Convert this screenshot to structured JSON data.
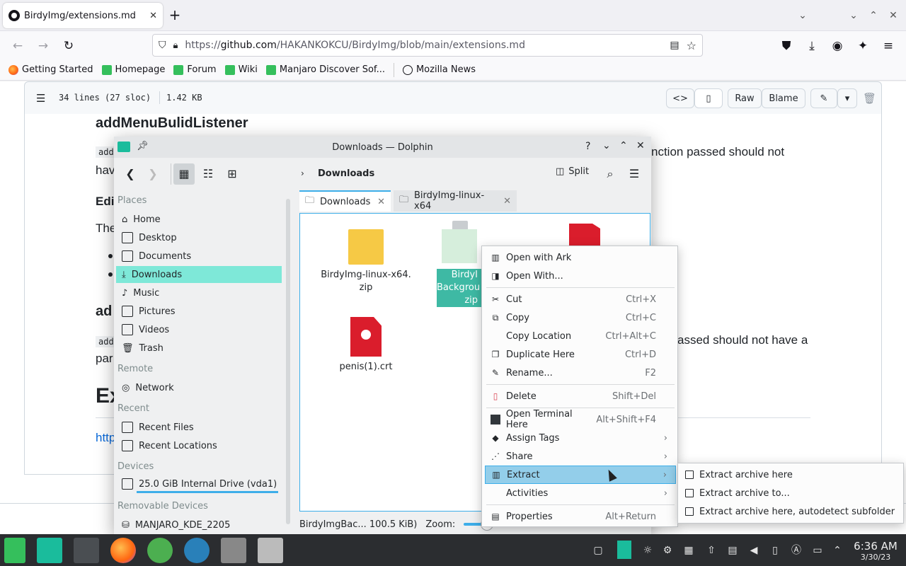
{
  "browser": {
    "tab_title": "BirdyImg/extensions.md at main",
    "url_host_prefix": "https://",
    "url_host": "github.com",
    "url_path": "/HAKANKOKCU/BirdyImg/blob/main/extensions.md",
    "bookmarks": [
      "Getting Started",
      "Homepage",
      "Forum",
      "Wiki",
      "Manjaro Discover Sof...",
      "Mozilla News"
    ]
  },
  "github": {
    "lines_info": "34 lines (27 sloc)",
    "size": "1.42 KB",
    "raw_label": "Raw",
    "blame_label": "Blame",
    "heading1": "addMenuBulidListener",
    "frag_code1": "add",
    "frag_text1": "nction passed should not",
    "frag_text2": "hav",
    "frag_edit": "Edi",
    "frag_the": "The",
    "frag_ad": "ad",
    "frag_code2": "add",
    "frag_text3": "assed should not have a",
    "frag_par": "par",
    "frag_big": "Ex",
    "frag_link": "http"
  },
  "dolphin": {
    "title": "Downloads — Dolphin",
    "breadcrumb": "Downloads",
    "split_label": "Split",
    "sidebar": {
      "places_header": "Places",
      "places": [
        "Home",
        "Desktop",
        "Documents",
        "Downloads",
        "Music",
        "Pictures",
        "Videos",
        "Trash"
      ],
      "remote_header": "Remote",
      "remote": [
        "Network"
      ],
      "recent_header": "Recent",
      "recent": [
        "Recent Files",
        "Recent Locations"
      ],
      "devices_header": "Devices",
      "devices": [
        "25.0 GiB Internal Drive (vda1)"
      ],
      "removable_header": "Removable Devices",
      "removable": [
        "MANJARO_KDE_2205"
      ]
    },
    "tabs": [
      "Downloads",
      "BirdyImg-linux-x64"
    ],
    "files": [
      {
        "name_line1": "BirdyImg-linux-x64.",
        "name_line2": "zip"
      },
      {
        "name_line1": "BirdyI",
        "name_line2": "Backgrou",
        "name_line3": "zip"
      },
      {
        "name_line1": "penis(1).crt"
      }
    ],
    "status_text": "BirdyImgBac... 100.5 KiB)",
    "zoom_label": "Zoom:"
  },
  "context_menu": {
    "items": [
      {
        "label": "Open with Ark",
        "shortcut": ""
      },
      {
        "label": "Open With...",
        "shortcut": ""
      },
      {
        "label": "Cut",
        "shortcut": "Ctrl+X"
      },
      {
        "label": "Copy",
        "shortcut": "Ctrl+C"
      },
      {
        "label": "Copy Location",
        "shortcut": "Ctrl+Alt+C"
      },
      {
        "label": "Duplicate Here",
        "shortcut": "Ctrl+D"
      },
      {
        "label": "Rename...",
        "shortcut": "F2"
      },
      {
        "label": "Delete",
        "shortcut": "Shift+Del"
      },
      {
        "label": "Open Terminal Here",
        "shortcut": "Alt+Shift+F4"
      },
      {
        "label": "Assign Tags",
        "shortcut": ""
      },
      {
        "label": "Share",
        "shortcut": ""
      },
      {
        "label": "Extract",
        "shortcut": ""
      },
      {
        "label": "Activities",
        "shortcut": ""
      },
      {
        "label": "Properties",
        "shortcut": "Alt+Return"
      }
    ],
    "submenu": [
      "Extract archive here",
      "Extract archive to...",
      "Extract archive here, autodetect subfolder"
    ]
  },
  "taskbar": {
    "time": "6:36 AM",
    "date": "3/30/23"
  },
  "colors": {
    "selection": "#7ee8d8",
    "highlight": "#93ceea",
    "accent": "#3daee9"
  }
}
